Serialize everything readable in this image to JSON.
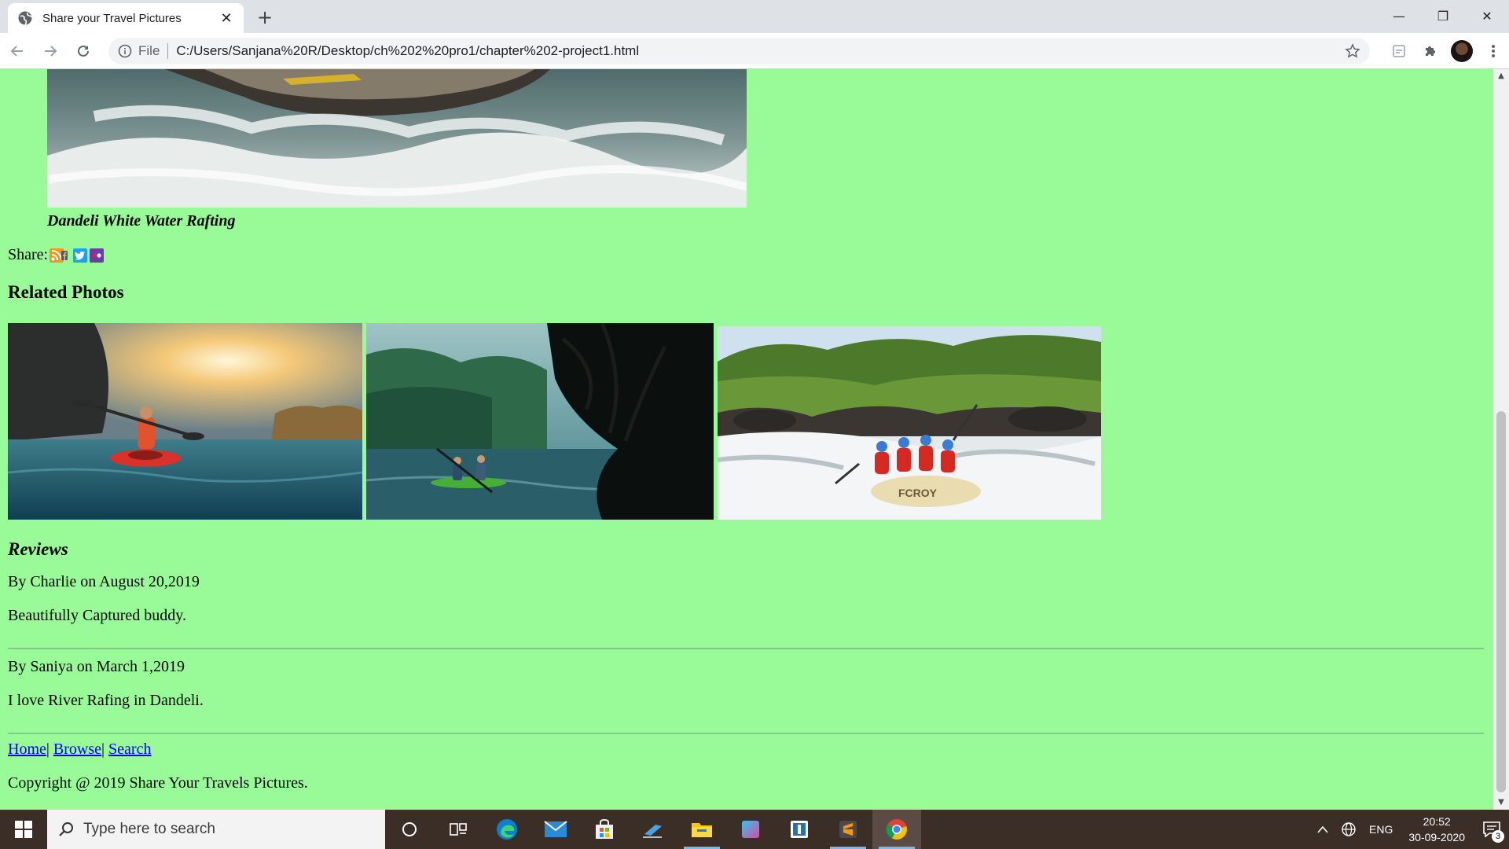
{
  "browser": {
    "tab_title": "Share your Travel Pictures",
    "tab_close": "✕",
    "new_tab": "+",
    "address_prefix": "File",
    "url": "C:/Users/Sanjana%20R/Desktop/ch%202%20pro1/chapter%202-project1.html",
    "window_controls": {
      "minimize": "—",
      "restore": "❐",
      "close": "✕"
    }
  },
  "page": {
    "main_photo_caption": "Dandeli White Water Rafting",
    "share_label": "Share:",
    "share_icons": [
      "rss-icon",
      "facebook-icon",
      "twitter-icon",
      "flickr-icon"
    ],
    "related_title": "Related Photos",
    "related_photos": [
      {
        "name": "kayak-sunset-photo"
      },
      {
        "name": "kayak-forest-river-photo"
      },
      {
        "name": "river-rafting-photo",
        "boat_text": "FCROY"
      }
    ],
    "reviews_title": "Reviews",
    "reviews": [
      {
        "by": "By Charlie on August 20,2019",
        "text": "Beautifully Captured buddy."
      },
      {
        "by": "By Saniya on March 1,2019",
        "text": "I love River Rafing in Dandeli."
      }
    ],
    "footer_links": {
      "home": "Home",
      "sep1": "|",
      "browse": "Browse",
      "sep2": "|",
      "search": "Search"
    },
    "copyright": "Copyright @ 2019 Share Your Travels Pictures."
  },
  "taskbar": {
    "search_placeholder": "Type here to search",
    "apps": [
      "cortana-icon",
      "task-view-icon",
      "edge-icon",
      "mail-icon",
      "store-icon",
      "people-icon",
      "file-explorer-icon",
      "paint3d-icon",
      "snip-icon",
      "sublime-icon",
      "chrome-icon"
    ],
    "language": "ENG",
    "time": "20:52",
    "date": "30-09-2020",
    "notification_count": "3"
  },
  "colors": {
    "page_background": "#98fb98",
    "link": "#0000ee",
    "taskbar": "#3a2e27"
  }
}
